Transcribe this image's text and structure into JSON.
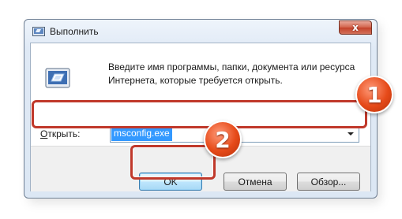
{
  "window": {
    "title": "Выполнить",
    "close_glyph": "x"
  },
  "dialog": {
    "description": "Введите имя программы, папки, документа или ресурса Интернета, которые требуется открыть.",
    "open_label_accel": "О",
    "open_label_rest": "ткрыть:",
    "input_value": "msconfig.exe"
  },
  "buttons": {
    "ok": "OK",
    "cancel": "Отмена",
    "browse_accel": "б",
    "browse_pre": "Об",
    "browse_text_before": "Об",
    "browse_rest": "зор..."
  },
  "annotations": {
    "badge_1": "1",
    "badge_2": "2",
    "highlight_color": "#c0392b",
    "badge_color": "#e64a19"
  }
}
